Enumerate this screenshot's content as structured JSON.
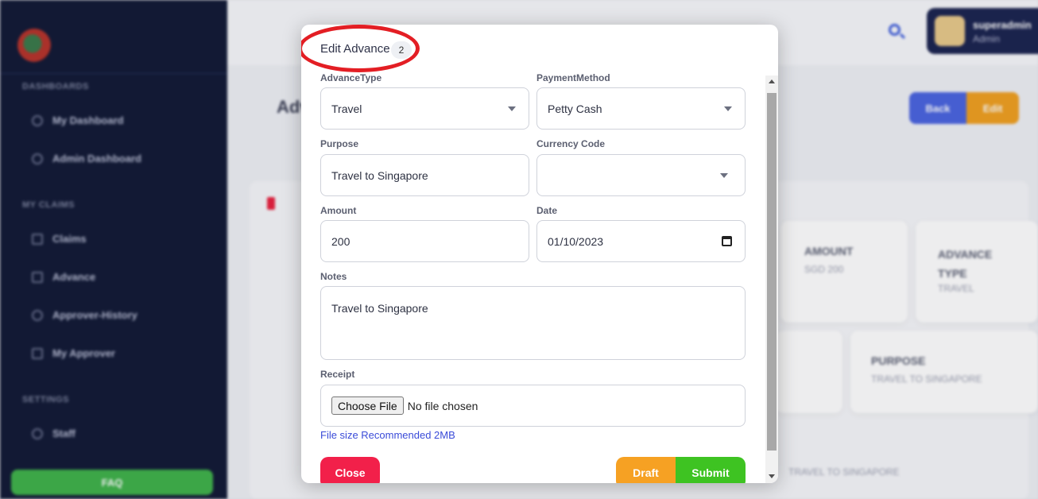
{
  "sidebar": {
    "sections": [
      "DASHBOARDS",
      "MY CLAIMS",
      "SETTINGS"
    ],
    "items": [
      {
        "label": "My Dashboard"
      },
      {
        "label": "Admin Dashboard"
      },
      {
        "label": "Claims"
      },
      {
        "label": "Advance"
      },
      {
        "label": "Approver-History"
      },
      {
        "label": "My Approver"
      },
      {
        "label": "Staff"
      }
    ],
    "faq_label": "FAQ"
  },
  "header": {
    "user_name": "superadmin",
    "user_role": "Admin"
  },
  "page": {
    "title_partial": "Adv",
    "back_label": "Back",
    "edit_label": "Edit",
    "cards": [
      {
        "heading": "AMOUNT",
        "value": "SGD 200"
      },
      {
        "heading": "ADVANCE\nTYPE",
        "value": "TRAVEL"
      },
      {
        "heading": "PURPOSE",
        "value": "TRAVEL TO SINGAPORE"
      },
      {
        "heading": "",
        "value": "TRAVEL TO SINGAPORE"
      }
    ]
  },
  "modal": {
    "title": "Edit Advance",
    "badge": "2",
    "fields": {
      "advance_type": {
        "label": "AdvanceType",
        "value": "Travel"
      },
      "payment_method": {
        "label": "PaymentMethod",
        "value": "Petty Cash"
      },
      "purpose": {
        "label": "Purpose",
        "value": "Travel to Singapore"
      },
      "currency_code": {
        "label": "Currency Code",
        "value": ""
      },
      "amount": {
        "label": "Amount",
        "value": "200"
      },
      "date": {
        "label": "Date",
        "value": "01/10/2023"
      },
      "notes": {
        "label": "Notes",
        "value": "Travel to Singapore"
      },
      "receipt": {
        "label": "Receipt",
        "button": "Choose File",
        "status": "No file chosen"
      }
    },
    "hint": "File size Recommended 2MB",
    "buttons": {
      "close": "Close",
      "draft": "Draft",
      "submit": "Submit"
    }
  },
  "colors": {
    "sidebar_bg": "#121a36",
    "close": "#f2204a",
    "draft": "#f6a123",
    "submit": "#3ec322",
    "highlight": "#e31e24",
    "link": "#3a4bd8"
  }
}
